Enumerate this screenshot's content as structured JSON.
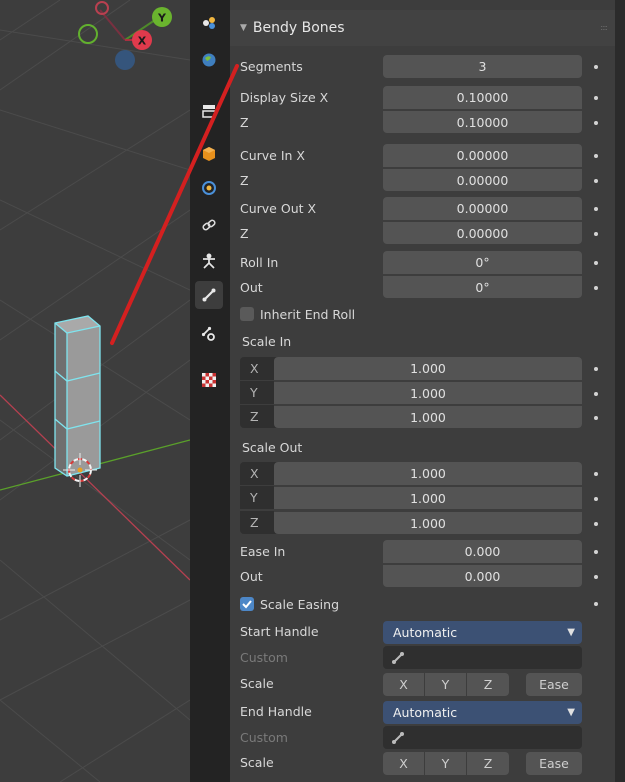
{
  "viewport": {
    "gizmo": {
      "x_label": "X",
      "y_label": "Y"
    }
  },
  "properties_tabs": [
    {
      "name": "tool-tab-icon"
    },
    {
      "name": "world-tab-icon"
    },
    {
      "name": "collection-tab-icon"
    },
    {
      "name": "object-tab-icon"
    },
    {
      "name": "modifiers-tab-icon"
    },
    {
      "name": "constraints-tab-icon"
    },
    {
      "name": "data-tab-icon"
    },
    {
      "name": "bone-tab-icon",
      "active": true
    },
    {
      "name": "bone-constraints-tab-icon"
    },
    {
      "name": "texture-tab-icon"
    }
  ],
  "panel": {
    "title": "Bendy Bones",
    "segments": {
      "label": "Segments",
      "value": "3"
    },
    "display_size": {
      "label_x": "Display Size X",
      "x": "0.10000",
      "label_z": "Z",
      "z": "0.10000"
    },
    "curve_in": {
      "label_x": "Curve In X",
      "x": "0.00000",
      "label_z": "Z",
      "z": "0.00000"
    },
    "curve_out": {
      "label_x": "Curve Out X",
      "x": "0.00000",
      "label_z": "Z",
      "z": "0.00000"
    },
    "roll_in": {
      "label": "Roll In",
      "value": "0°"
    },
    "roll_out": {
      "label": "Out",
      "value": "0°"
    },
    "inherit_end_roll": {
      "label": "Inherit End Roll",
      "checked": false
    },
    "scale_in": {
      "label": "Scale In",
      "x_label": "X",
      "x": "1.000",
      "y_label": "Y",
      "y": "1.000",
      "z_label": "Z",
      "z": "1.000"
    },
    "scale_out": {
      "label": "Scale Out",
      "x_label": "X",
      "x": "1.000",
      "y_label": "Y",
      "y": "1.000",
      "z_label": "Z",
      "z": "1.000"
    },
    "ease_in": {
      "label": "Ease In",
      "value": "0.000"
    },
    "ease_out": {
      "label": "Out",
      "value": "0.000"
    },
    "scale_easing": {
      "label": "Scale Easing",
      "checked": true
    },
    "start_handle": {
      "label": "Start Handle",
      "value": "Automatic",
      "custom_label": "Custom",
      "scale_label": "Scale",
      "x": "X",
      "y": "Y",
      "z": "Z",
      "ease": "Ease"
    },
    "end_handle": {
      "label": "End Handle",
      "value": "Automatic",
      "custom_label": "Custom",
      "scale_label": "Scale",
      "x": "X",
      "y": "Y",
      "z": "Z",
      "ease": "Ease"
    }
  },
  "colors": {
    "annotation_arrow": "#d42020",
    "bone_selected": "#7fe4ee",
    "x_axis": "#e03a4c",
    "y_axis": "#6ab42e",
    "z_axis": "#3b6fb0",
    "dropdown": "#3c5174",
    "checkbox_on": "#4d87c7"
  }
}
